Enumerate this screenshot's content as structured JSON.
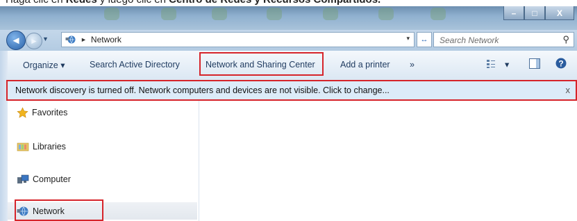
{
  "caption": {
    "prefix": "Haga clic en ",
    "bold1": "Redes",
    "middle": " y luego clic en ",
    "bold2": "Centro de Redes y Recursos Compartidos."
  },
  "window": {
    "minimize_glyph": "–",
    "maximize_glyph": "□",
    "close_glyph": "X"
  },
  "address": {
    "location": "Network",
    "separator": "►",
    "dropdown": "▾",
    "refresh": "↔"
  },
  "search": {
    "placeholder": "Search Network",
    "icon": "search-icon"
  },
  "toolbar": {
    "organize": "Organize ▾",
    "search_ad": "Search Active Directory",
    "network_sharing": "Network and Sharing Center",
    "add_printer": "Add a printer",
    "more": "»",
    "view_drop": "▾"
  },
  "infobar": {
    "message": "Network discovery is turned off. Network computers and devices are not visible. Click to change...",
    "close": "x"
  },
  "nav": {
    "items": [
      {
        "label": "Favorites",
        "icon": "star-icon"
      },
      {
        "label": "Libraries",
        "icon": "libraries-icon"
      },
      {
        "label": "Computer",
        "icon": "computer-icon"
      },
      {
        "label": "Network",
        "icon": "network-icon"
      }
    ]
  },
  "colors": {
    "highlight": "#d6242a",
    "infobar": "#dcebf8",
    "toolbar_text": "#1e3a5f"
  }
}
